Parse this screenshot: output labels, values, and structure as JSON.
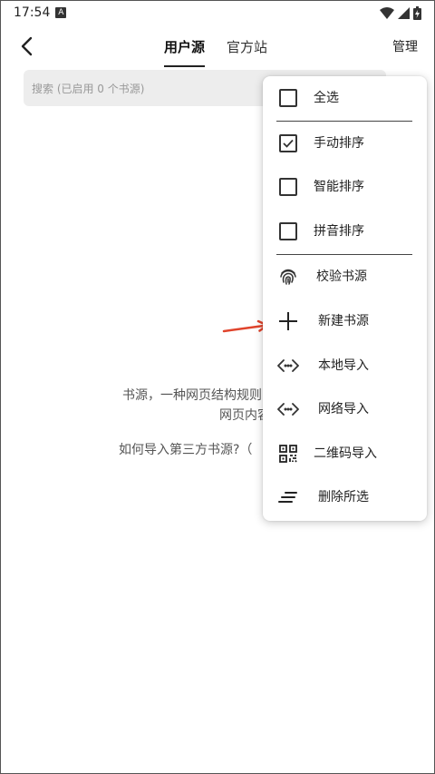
{
  "status_bar": {
    "time": "17:54",
    "notif_icon": "A"
  },
  "app_bar": {
    "tabs": [
      {
        "label": "用户源"
      },
      {
        "label": "官方站"
      }
    ],
    "manage_label": "管理"
  },
  "search": {
    "placeholder": "搜索 (已启用 0 个书源)"
  },
  "empty": {
    "desc_line1": "书源，一种网页结构规则的描述，通",
    "desc_line2": "网页内容。",
    "how_import": "如何导入第三方书源?（"
  },
  "menu": {
    "select_all": "全选",
    "manual_sort": "手动排序",
    "smart_sort": "智能排序",
    "pinyin_sort": "拼音排序",
    "check_source": "校验书源",
    "new_source": "新建书源",
    "local_import": "本地导入",
    "network_import": "网络导入",
    "qr_import": "二维码导入",
    "delete_selected": "删除所选",
    "manual_sort_checked": true
  },
  "colors": {
    "arrow": "#e0442c"
  }
}
